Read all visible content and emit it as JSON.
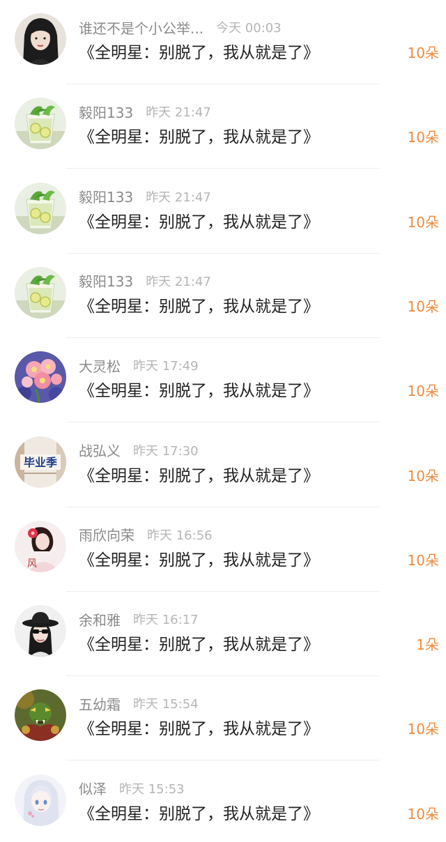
{
  "theme": {
    "accent": "#f08a3c",
    "name_color": "#8a8a8a",
    "time_color": "#b5b5b5"
  },
  "gifts": [
    {
      "name": "谁还不是个小公举...",
      "time": "今天 00:03",
      "message": "《全明星：别脱了，我从就是了》",
      "amount": "10朵",
      "avatar": "girl-dark-hair"
    },
    {
      "name": "毅阳133",
      "time": "昨天 21:47",
      "message": "《全明星：别脱了，我从就是了》",
      "amount": "10朵",
      "avatar": "lemon-drink"
    },
    {
      "name": "毅阳133",
      "time": "昨天 21:47",
      "message": "《全明星：别脱了，我从就是了》",
      "amount": "10朵",
      "avatar": "lemon-drink"
    },
    {
      "name": "毅阳133",
      "time": "昨天 21:47",
      "message": "《全明星：别脱了，我从就是了》",
      "amount": "10朵",
      "avatar": "lemon-drink"
    },
    {
      "name": "大灵松",
      "time": "昨天 17:49",
      "message": "《全明星：别脱了，我从就是了》",
      "amount": "10朵",
      "avatar": "pink-flowers"
    },
    {
      "name": "战弘义",
      "time": "昨天 17:30",
      "message": "《全明星：别脱了，我从就是了》",
      "amount": "10朵",
      "avatar": "graduation-text",
      "avatar_text": "毕业季"
    },
    {
      "name": "雨欣向荣",
      "time": "昨天 16:56",
      "message": "《全明星：别脱了，我从就是了》",
      "amount": "10朵",
      "avatar": "girl-red-flower",
      "avatar_text": "风"
    },
    {
      "name": "余和雅",
      "time": "昨天 16:17",
      "message": "《全明星：别脱了，我从就是了》",
      "amount": "1朵",
      "avatar": "woman-hat-sunglasses"
    },
    {
      "name": "五幼霜",
      "time": "昨天 15:54",
      "message": "《全明星：别脱了，我从就是了》",
      "amount": "10朵",
      "avatar": "game-orc-warrior"
    },
    {
      "name": "似泽",
      "time": "昨天 15:53",
      "message": "《全明星：别脱了，我从就是了》",
      "amount": "10朵",
      "avatar": "anime-white-hair"
    }
  ]
}
